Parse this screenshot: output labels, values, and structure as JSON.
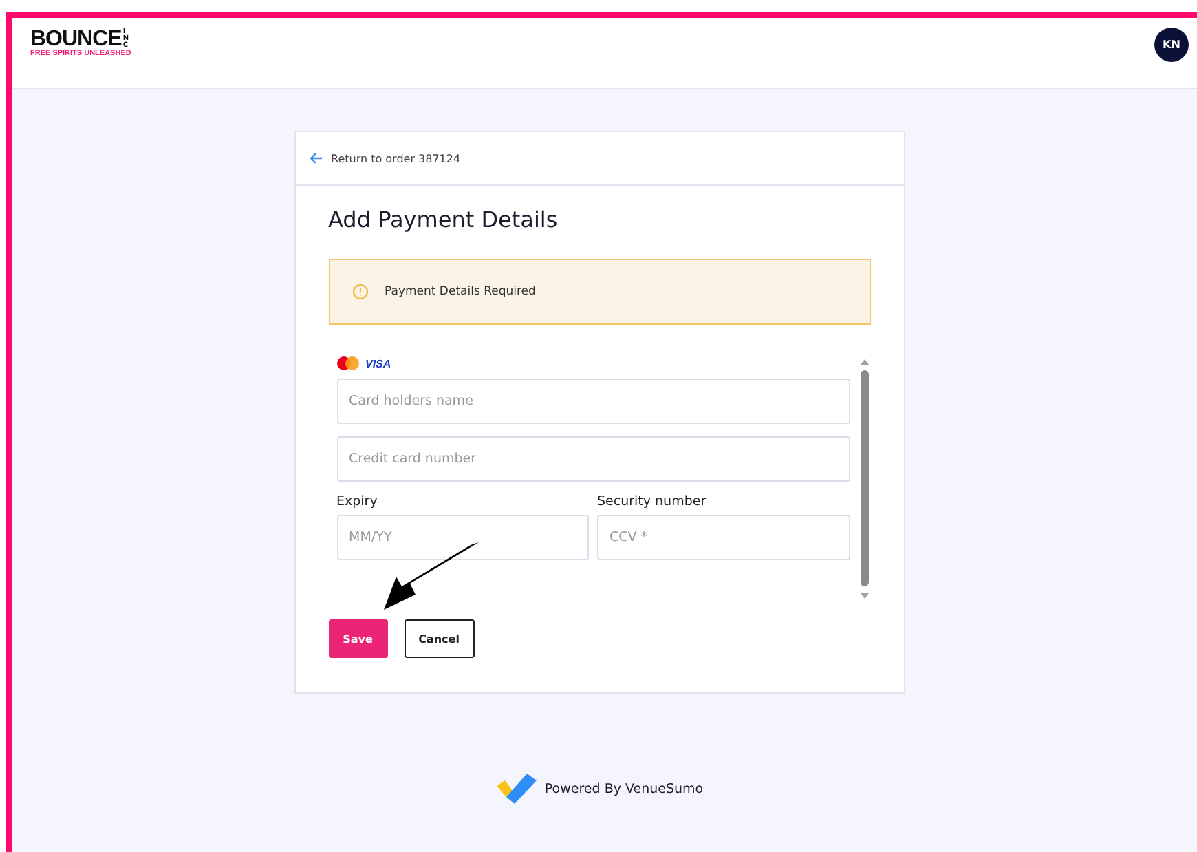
{
  "header": {
    "logo": {
      "wordmark": "BOUNCE",
      "suffix": "INC",
      "tagline": "FREE SPIRITS UNLEASHED"
    },
    "avatar": "KN"
  },
  "card": {
    "back_link": "Return to order 387124",
    "title": "Add Payment Details",
    "alert": {
      "text": "Payment Details Required"
    },
    "card_brands": [
      "VISA"
    ],
    "fields": [
      {
        "placeholder": "Card holders name"
      },
      {
        "placeholder": "Credit card number"
      }
    ],
    "split_fields": [
      {
        "label": "Expiry",
        "placeholder": "MM/YY"
      },
      {
        "label": "Security number",
        "placeholder": "CCV *"
      }
    ],
    "buttons": [
      {
        "label": "Save",
        "kind": "primary"
      },
      {
        "label": "Cancel",
        "kind": "secondary"
      }
    ]
  },
  "footer": {
    "text": "Powered By VenueSumo"
  }
}
